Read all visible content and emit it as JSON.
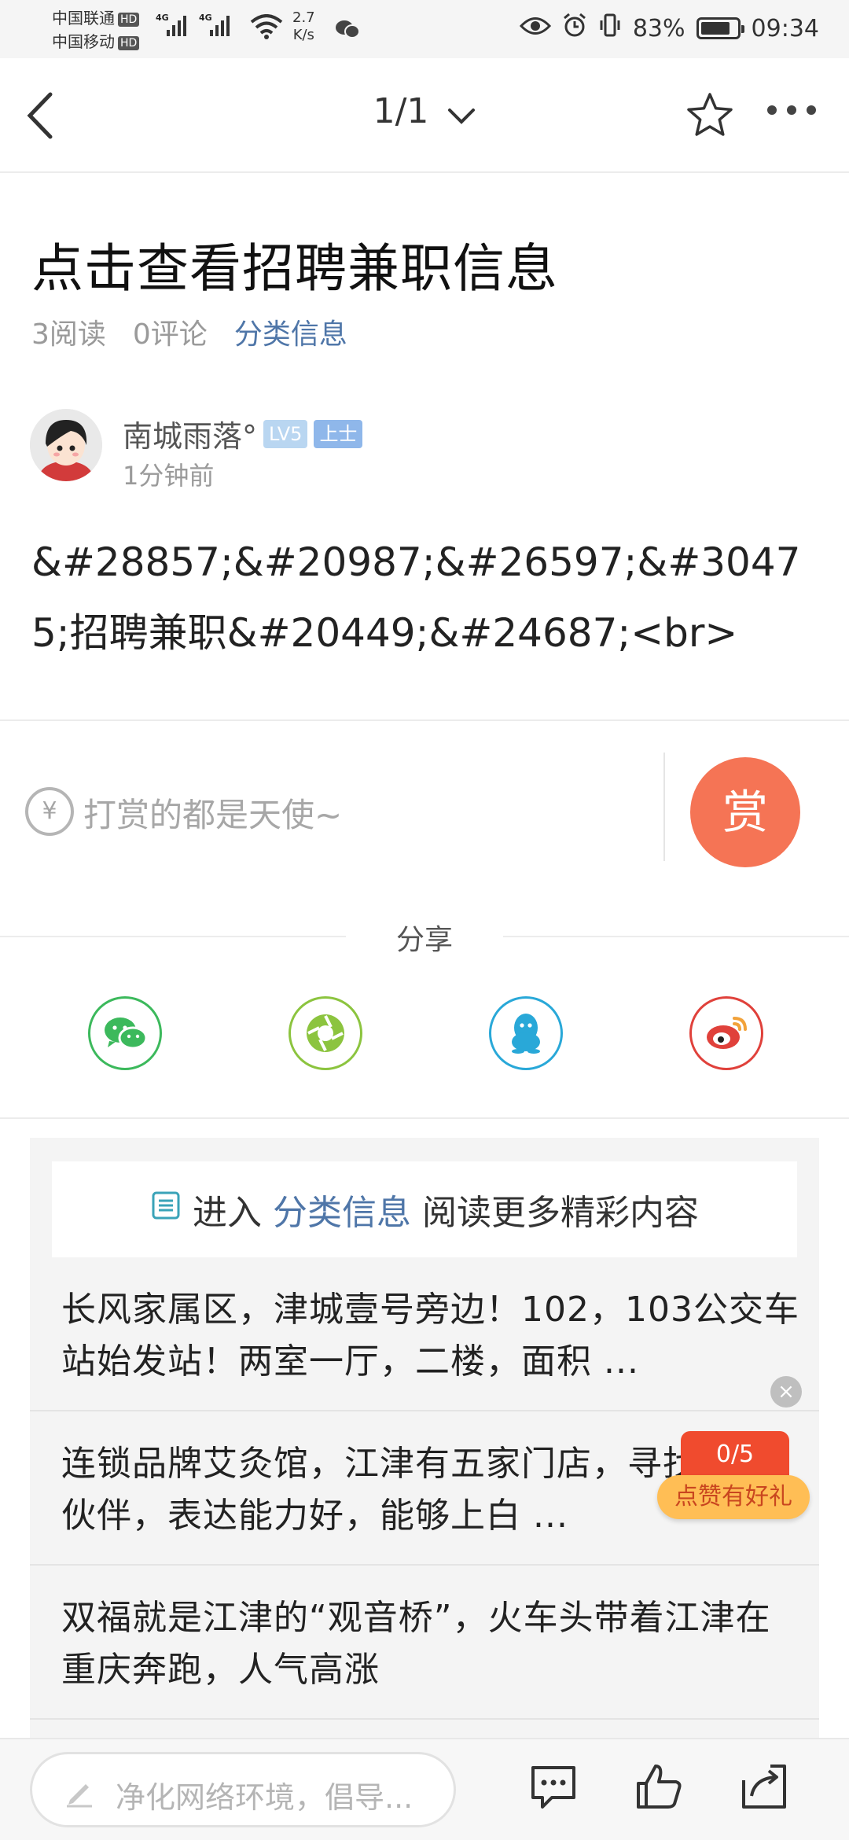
{
  "status_bar": {
    "carrier1": "中国联通",
    "carrier2": "中国移动",
    "hd": "HD",
    "network": "4G",
    "speed_value": "2.7",
    "speed_unit": "K/s",
    "battery": "83%",
    "battery_level": 0.83,
    "time": "09:34"
  },
  "nav": {
    "pager": "1/1"
  },
  "article": {
    "title": "点击查看招聘兼职信息",
    "reads": "3阅读",
    "comments": "0评论",
    "category": "分类信息",
    "author": "南城雨落°",
    "level": "LV5",
    "rank": "上士",
    "time": "1分钟前",
    "body": "&#28857;&#20987;&#26597;&#30475;招聘兼职&#20449;&#24687;<br>"
  },
  "reward": {
    "currency_symbol": "¥",
    "placeholder": "打赏的都是天使~",
    "button": "赏"
  },
  "share": {
    "label": "分享"
  },
  "more": {
    "prefix": "进入",
    "category": "分类信息",
    "suffix": "阅读更多精彩内容",
    "items": [
      "长风家属区，津城壹号旁边！102，103公交车站始发站！两室一厅，二楼，面积 ...",
      "连锁品牌艾灸馆，江津有五家门店，寻找合作伙伴，表达能力好，能够上白 ...",
      "双福就是江津的“观音桥”，火车头带着江津在重庆奔跑，人气高涨"
    ]
  },
  "like_popup": {
    "close": "×",
    "count": "0/5",
    "label": "点赞有好礼"
  },
  "bottom_bar": {
    "comment_placeholder": "净化网络环境，倡导..."
  },
  "colors": {
    "accent_link": "#4f76a8",
    "reward": "#f57455",
    "wechat": "#3cb95c",
    "moments": "#8cc43f",
    "qq": "#29a8d8",
    "weibo": "#e0413b"
  }
}
